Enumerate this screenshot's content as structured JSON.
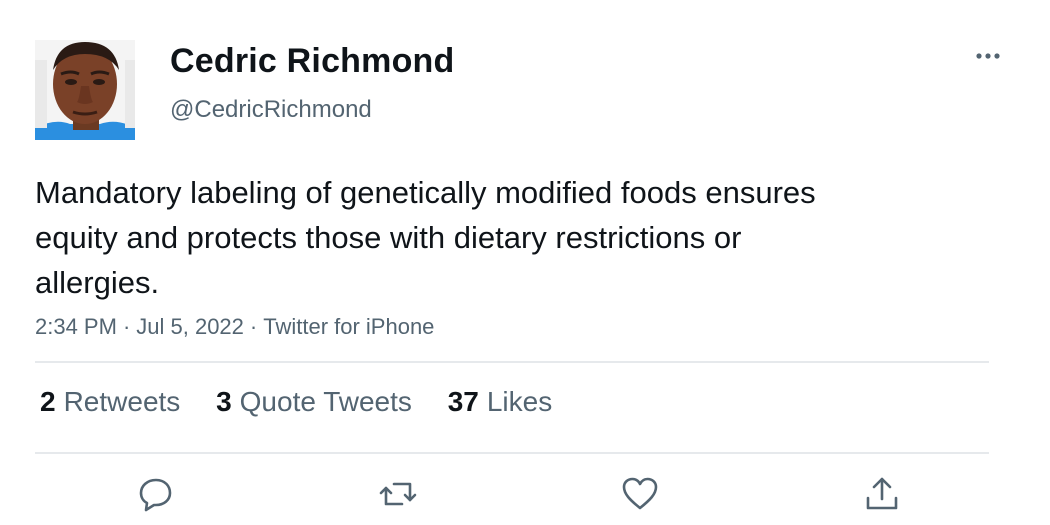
{
  "author": {
    "display_name": "Cedric Richmond",
    "handle": "@CedricRichmond"
  },
  "tweet": {
    "text": "Mandatory labeling of genetically modified foods ensures equity and protects those with dietary restrictions or allergies.",
    "time": "2:34 PM",
    "date": "Jul 5, 2022",
    "source": "Twitter for iPhone",
    "separator": "·"
  },
  "stats": {
    "retweets": {
      "count": "2",
      "label": "Retweets"
    },
    "quote_tweets": {
      "count": "3",
      "label": "Quote Tweets"
    },
    "likes": {
      "count": "37",
      "label": "Likes"
    }
  },
  "icons": {
    "more": "more-options-icon",
    "reply": "reply-icon",
    "retweet": "retweet-icon",
    "like": "heart-icon",
    "share": "share-icon"
  },
  "colors": {
    "text_primary": "#0f1419",
    "text_secondary": "#536471",
    "divider": "#e6e9ec",
    "avatar_shirt": "#2b8fe0"
  }
}
